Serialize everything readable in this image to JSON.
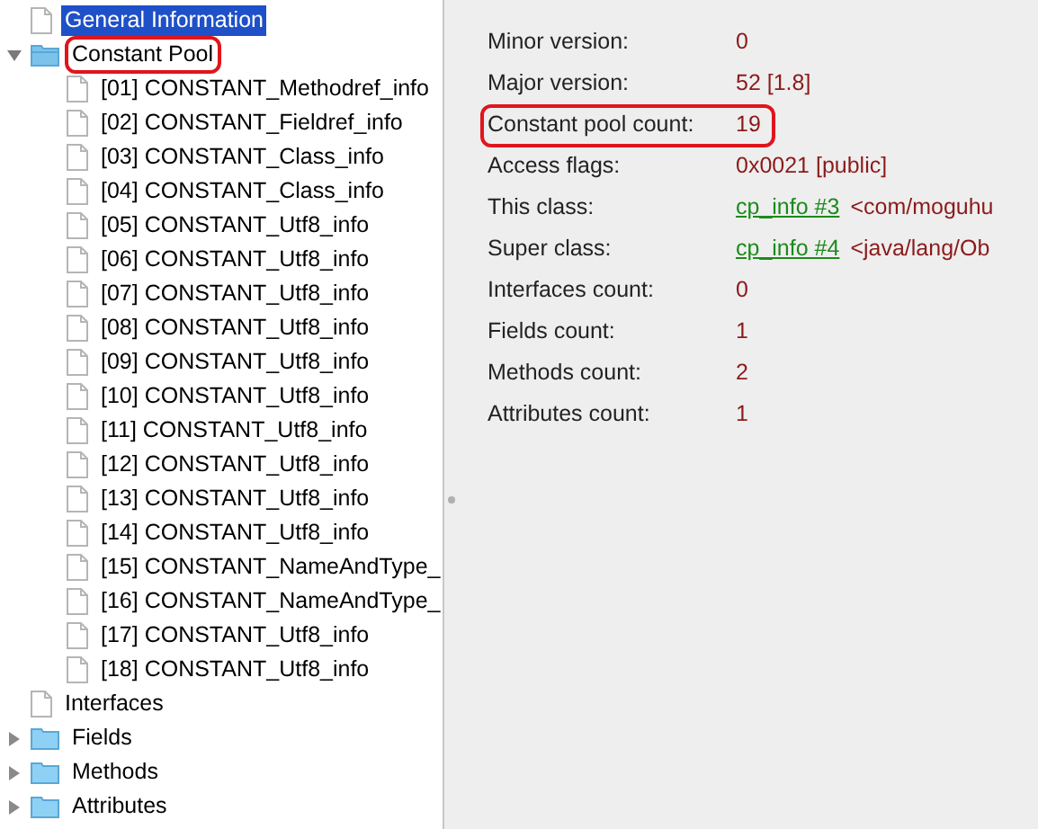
{
  "tree": [
    {
      "label": "General Information",
      "kind": "file",
      "selected": true,
      "annotated": false
    },
    {
      "label": "Constant Pool",
      "kind": "folder",
      "selected": false,
      "expanded": true,
      "annotated": true,
      "children": [
        {
          "label": "[01] CONSTANT_Methodref_info",
          "kind": "file",
          "selected": false
        },
        {
          "label": "[02] CONSTANT_Fieldref_info",
          "kind": "file",
          "selected": false
        },
        {
          "label": "[03] CONSTANT_Class_info",
          "kind": "file",
          "selected": false
        },
        {
          "label": "[04] CONSTANT_Class_info",
          "kind": "file",
          "selected": false
        },
        {
          "label": "[05] CONSTANT_Utf8_info",
          "kind": "file",
          "selected": false
        },
        {
          "label": "[06] CONSTANT_Utf8_info",
          "kind": "file",
          "selected": false
        },
        {
          "label": "[07] CONSTANT_Utf8_info",
          "kind": "file",
          "selected": false
        },
        {
          "label": "[08] CONSTANT_Utf8_info",
          "kind": "file",
          "selected": false
        },
        {
          "label": "[09] CONSTANT_Utf8_info",
          "kind": "file",
          "selected": false
        },
        {
          "label": "[10] CONSTANT_Utf8_info",
          "kind": "file",
          "selected": false
        },
        {
          "label": "[11] CONSTANT_Utf8_info",
          "kind": "file",
          "selected": false
        },
        {
          "label": "[12] CONSTANT_Utf8_info",
          "kind": "file",
          "selected": false
        },
        {
          "label": "[13] CONSTANT_Utf8_info",
          "kind": "file",
          "selected": false
        },
        {
          "label": "[14] CONSTANT_Utf8_info",
          "kind": "file",
          "selected": false
        },
        {
          "label": "[15] CONSTANT_NameAndType_",
          "kind": "file",
          "selected": false
        },
        {
          "label": "[16] CONSTANT_NameAndType_",
          "kind": "file",
          "selected": false
        },
        {
          "label": "[17] CONSTANT_Utf8_info",
          "kind": "file",
          "selected": false
        },
        {
          "label": "[18] CONSTANT_Utf8_info",
          "kind": "file",
          "selected": false
        }
      ]
    },
    {
      "label": "Interfaces",
      "kind": "file",
      "selected": false,
      "annotated": false
    },
    {
      "label": "Fields",
      "kind": "folder",
      "selected": false,
      "expanded": false,
      "annotated": false
    },
    {
      "label": "Methods",
      "kind": "folder",
      "selected": false,
      "expanded": false,
      "annotated": false
    },
    {
      "label": "Attributes",
      "kind": "folder",
      "selected": false,
      "expanded": false,
      "annotated": false
    }
  ],
  "details": [
    {
      "label": "Minor version:",
      "value": "0",
      "annotated": false
    },
    {
      "label": "Major version:",
      "value": "52 [1.8]",
      "annotated": false
    },
    {
      "label": "Constant pool count:",
      "value": "19",
      "annotated": true
    },
    {
      "label": "Access flags:",
      "value": "0x0021 [public]",
      "annotated": false
    },
    {
      "label": "This class:",
      "link": "cp_info #3",
      "value": "<com/moguhu",
      "annotated": false
    },
    {
      "label": "Super class:",
      "link": "cp_info #4",
      "value": "<java/lang/Ob",
      "annotated": false
    },
    {
      "label": "Interfaces count:",
      "value": "0",
      "annotated": false
    },
    {
      "label": "Fields count:",
      "value": "1",
      "annotated": false
    },
    {
      "label": "Methods count:",
      "value": "2",
      "annotated": false
    },
    {
      "label": "Attributes count:",
      "value": "1",
      "annotated": false
    }
  ]
}
